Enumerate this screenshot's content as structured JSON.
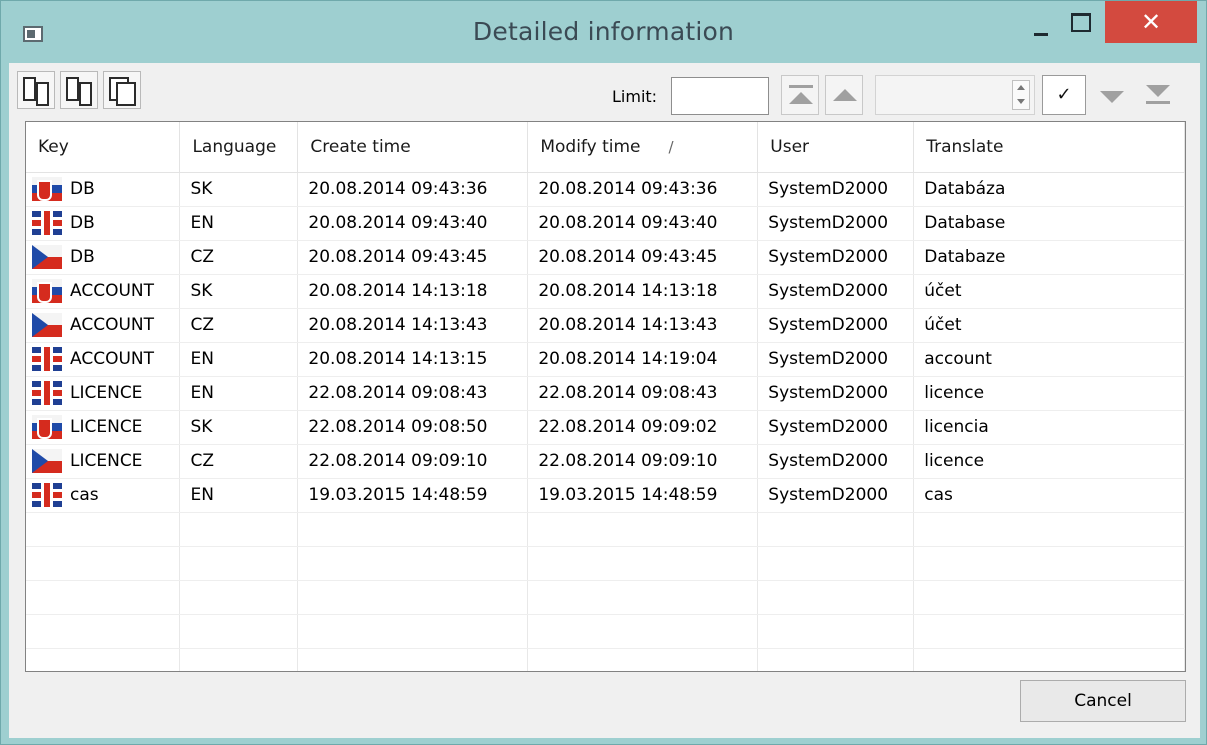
{
  "window": {
    "title": "Detailed information"
  },
  "toolbar": {
    "icons": [
      "export-icon",
      "import-icon",
      "merge-icon"
    ],
    "limit_label": "Limit:",
    "limit_value": "",
    "spin_value": ""
  },
  "grid": {
    "columns": [
      "Key",
      "Language",
      "Create time",
      "Modify time",
      "User",
      "Translate"
    ],
    "sort_indicator": "/",
    "rows": [
      {
        "flag": "sk",
        "key": "DB",
        "language": "SK",
        "create": "20.08.2014 09:43:36",
        "modify": "20.08.2014 09:43:36",
        "user": "SystemD2000",
        "translate": "Databáza"
      },
      {
        "flag": "en",
        "key": "DB",
        "language": "EN",
        "create": "20.08.2014 09:43:40",
        "modify": "20.08.2014 09:43:40",
        "user": "SystemD2000",
        "translate": "Database"
      },
      {
        "flag": "cz",
        "key": "DB",
        "language": "CZ",
        "create": "20.08.2014 09:43:45",
        "modify": "20.08.2014 09:43:45",
        "user": "SystemD2000",
        "translate": "Databaze"
      },
      {
        "flag": "sk",
        "key": "ACCOUNT",
        "language": "SK",
        "create": "20.08.2014 14:13:18",
        "modify": "20.08.2014 14:13:18",
        "user": "SystemD2000",
        "translate": "účet"
      },
      {
        "flag": "cz",
        "key": "ACCOUNT",
        "language": "CZ",
        "create": "20.08.2014 14:13:43",
        "modify": "20.08.2014 14:13:43",
        "user": "SystemD2000",
        "translate": "účet"
      },
      {
        "flag": "en",
        "key": "ACCOUNT",
        "language": "EN",
        "create": "20.08.2014 14:13:15",
        "modify": "20.08.2014 14:19:04",
        "user": "SystemD2000",
        "translate": "account"
      },
      {
        "flag": "en",
        "key": "LICENCE",
        "language": "EN",
        "create": "22.08.2014 09:08:43",
        "modify": "22.08.2014 09:08:43",
        "user": "SystemD2000",
        "translate": "licence"
      },
      {
        "flag": "sk",
        "key": "LICENCE",
        "language": "SK",
        "create": "22.08.2014 09:08:50",
        "modify": "22.08.2014 09:09:02",
        "user": "SystemD2000",
        "translate": "licencia"
      },
      {
        "flag": "cz",
        "key": "LICENCE",
        "language": "CZ",
        "create": "22.08.2014 09:09:10",
        "modify": "22.08.2014 09:09:10",
        "user": "SystemD2000",
        "translate": "licence"
      },
      {
        "flag": "en",
        "key": "cas",
        "language": "EN",
        "create": "19.03.2015 14:48:59",
        "modify": "19.03.2015 14:48:59",
        "user": "SystemD2000",
        "translate": "cas"
      }
    ]
  },
  "footer": {
    "cancel_label": "Cancel"
  }
}
